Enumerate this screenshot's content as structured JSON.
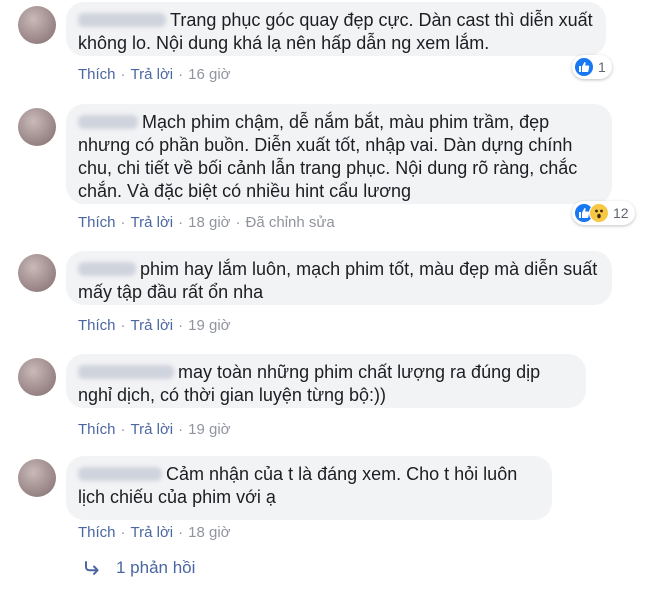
{
  "comments": [
    {
      "text": "Trang phục góc quay đẹp cực. Dàn cast thì diễn xuất không lo. Nội dung khá lạ nên hấp dẫn ng xem lắm.",
      "like_label": "Thích",
      "reply_label": "Trả lời",
      "time": "16 giờ",
      "reaction_icons": [
        "like-icon"
      ],
      "reaction_count": "1"
    },
    {
      "text": "Mạch phim chậm, dễ nắm bắt, màu phim trầm, đẹp nhưng có phần buồn. Diễn xuất tốt, nhập vai. Dàn dựng chính chu, chi tiết về bối cảnh lẫn trang phục. Nội dung rõ ràng, chắc chắn. Và đặc biệt có nhiều hint cẩu lương",
      "like_label": "Thích",
      "reply_label": "Trả lời",
      "time": "18 giờ",
      "edited": "Đã chỉnh sửa",
      "reaction_icons": [
        "like-icon",
        "wow-icon"
      ],
      "reaction_count": "12"
    },
    {
      "text": "phim hay lắm luôn, mạch phim tốt, màu đẹp mà diễn suất mấy tập đầu rất ổn nha",
      "like_label": "Thích",
      "reply_label": "Trả lời",
      "time": "19 giờ"
    },
    {
      "text": "may toàn những phim chất lượng ra đúng dịp nghỉ dịch, có thời gian luyện từng bộ:))",
      "like_label": "Thích",
      "reply_label": "Trả lời",
      "time": "19 giờ"
    },
    {
      "text": "Cảm nhận của t là đáng xem. Cho t hỏi luôn lịch chiếu của phim với ạ",
      "like_label": "Thích",
      "reply_label": "Trả lời",
      "time": "18 giờ"
    }
  ],
  "replies_label": "1 phản hồi",
  "colors": {
    "bubble": "#f2f3f5",
    "link": "#4b67a1",
    "meta": "#90949c",
    "like": "#1877f2",
    "wow": "#f7c843"
  }
}
